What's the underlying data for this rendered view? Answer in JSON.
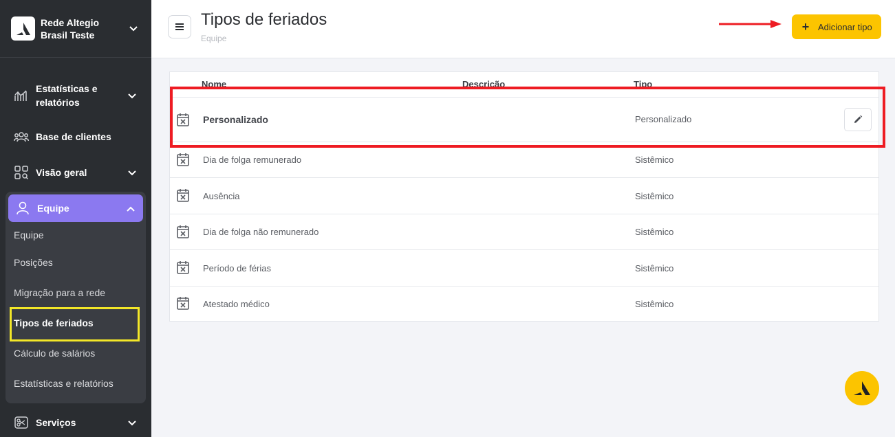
{
  "brand": {
    "name": "Rede Altegio Brasil Teste"
  },
  "sidebar": {
    "items": [
      {
        "label": "Estatísticas e relatórios",
        "icon": "stats-icon"
      },
      {
        "label": "Base de clientes",
        "icon": "clients-icon"
      },
      {
        "label": "Visão geral",
        "icon": "overview-icon"
      },
      {
        "label": "Equipe",
        "icon": "user-icon"
      },
      {
        "label": "Serviços",
        "icon": "scissors-icon"
      }
    ],
    "team_sub": [
      {
        "label": "Equipe"
      },
      {
        "label": "Posições"
      },
      {
        "label": "Migração para a rede"
      },
      {
        "label": "Tipos de feriados"
      },
      {
        "label": "Cálculo de salários"
      },
      {
        "label": "Estatísticas e relatórios"
      }
    ]
  },
  "header": {
    "title": "Tipos de feriados",
    "breadcrumb": "Equipe",
    "add_button": "Adicionar tipo"
  },
  "table": {
    "columns": [
      "Nome",
      "Descrição",
      "Tipo"
    ],
    "rows": [
      {
        "name": "Personalizado",
        "type": "Personalizado"
      },
      {
        "name": "Dia de folga remunerado",
        "type": "Sistêmico"
      },
      {
        "name": "Ausência",
        "type": "Sistêmico"
      },
      {
        "name": "Dia de folga não remunerado",
        "type": "Sistêmico"
      },
      {
        "name": "Período de férias",
        "type": "Sistêmico"
      },
      {
        "name": "Atestado médico",
        "type": "Sistêmico"
      }
    ]
  },
  "colors": {
    "accent": "#8b79f0",
    "button": "#fcc400",
    "sidebar": "#2a2d31",
    "annotation_red": "#ee1c23",
    "annotation_yellow": "#f3e728"
  }
}
